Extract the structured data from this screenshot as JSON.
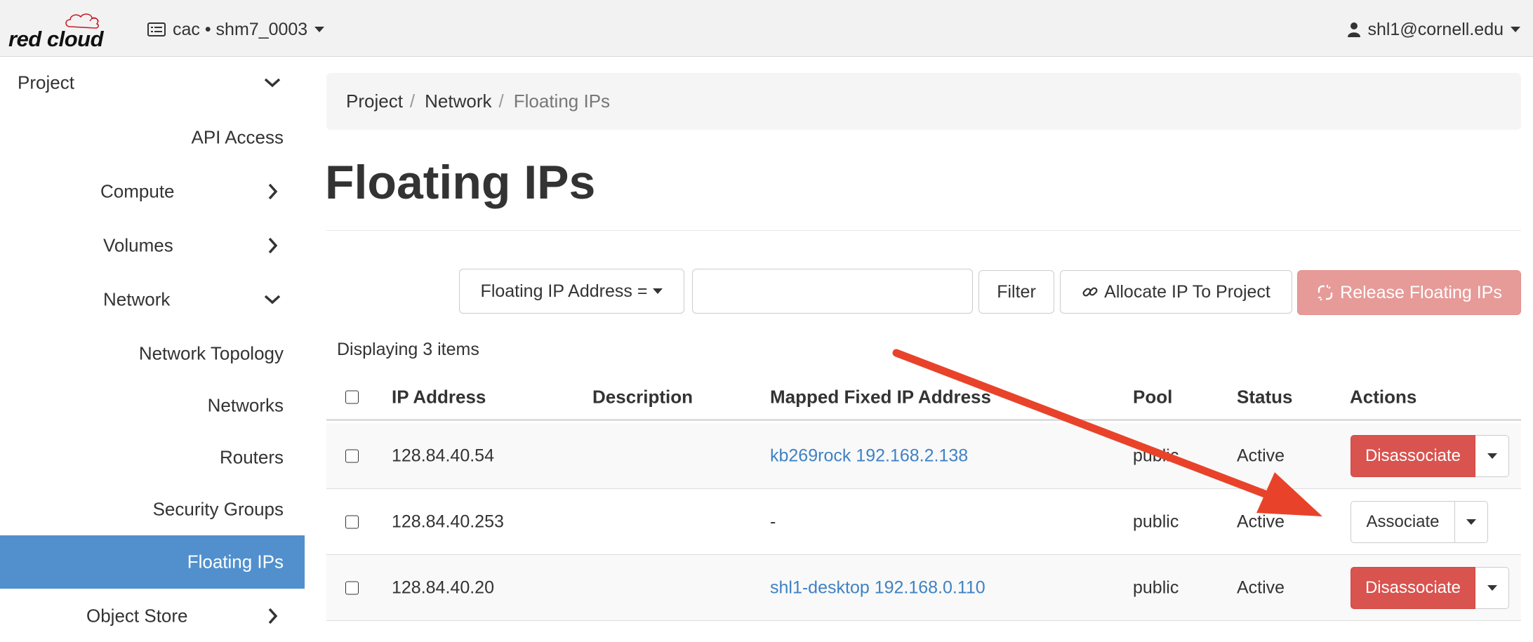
{
  "header": {
    "logo_text": "red cloud",
    "project_label": "cac • shm7_0003",
    "user_label": "shl1@cornell.edu"
  },
  "sidebar": {
    "items": [
      {
        "label": "Project",
        "chevron": "down"
      },
      {
        "label": "API Access"
      },
      {
        "label": "Compute",
        "chevron": "right"
      },
      {
        "label": "Volumes",
        "chevron": "right"
      },
      {
        "label": "Network",
        "chevron": "down"
      },
      {
        "label": "Network Topology"
      },
      {
        "label": "Networks"
      },
      {
        "label": "Routers"
      },
      {
        "label": "Security Groups"
      },
      {
        "label": "Floating IPs",
        "active": true
      },
      {
        "label": "Object Store",
        "chevron": "right"
      }
    ]
  },
  "breadcrumb": [
    "Project",
    "Network",
    "Floating IPs"
  ],
  "page_title": "Floating IPs",
  "toolbar": {
    "filter_select": "Floating IP Address =",
    "filter_input_value": "",
    "filter_button": "Filter",
    "allocate_button": "Allocate IP To Project",
    "release_button": "Release Floating IPs"
  },
  "table": {
    "count_text": "Displaying 3 items",
    "headers": [
      "IP Address",
      "Description",
      "Mapped Fixed IP Address",
      "Pool",
      "Status",
      "Actions"
    ],
    "rows": [
      {
        "ip": "128.84.40.54",
        "description": "",
        "mapped": "kb269rock 192.168.2.138",
        "pool": "public",
        "status": "Active",
        "action": "Disassociate"
      },
      {
        "ip": "128.84.40.253",
        "description": "",
        "mapped": "-",
        "pool": "public",
        "status": "Active",
        "action": "Associate"
      },
      {
        "ip": "128.84.40.20",
        "description": "",
        "mapped": "shl1-desktop 192.168.0.110",
        "pool": "public",
        "status": "Active",
        "action": "Disassociate"
      }
    ]
  },
  "colors": {
    "active_nav": "#5190cd",
    "danger": "#d9534f",
    "release_disabled": "#e69b98",
    "link": "#3f82c4",
    "annotation_arrow": "#e8432a"
  }
}
